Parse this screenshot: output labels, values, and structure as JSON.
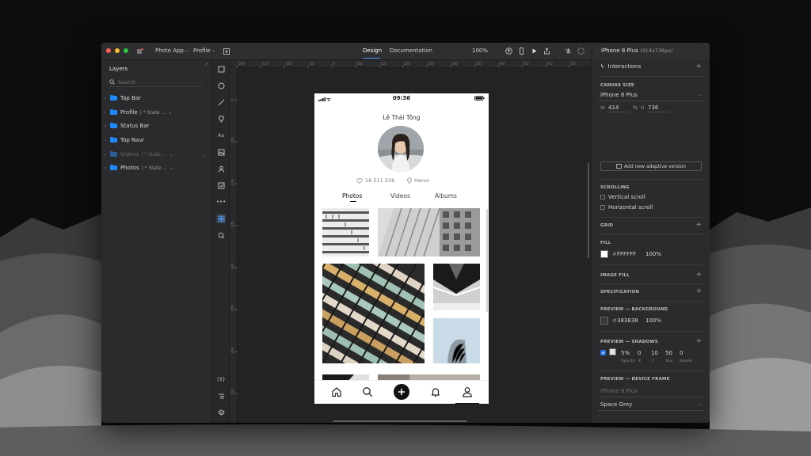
{
  "titlebar": {
    "project": "Photo App",
    "separator": "—",
    "page": "Profile",
    "tabs": [
      "Design",
      "Documentation"
    ],
    "zoom": "100%"
  },
  "layers": {
    "title": "Layers",
    "search_placeholder": "Search",
    "items": [
      {
        "name": "Tap Bar",
        "state": ""
      },
      {
        "name": "Profile",
        "state": "| * State ..."
      },
      {
        "name": "Status Bar",
        "state": ""
      },
      {
        "name": "Top Navi",
        "state": ""
      },
      {
        "name": "Videos",
        "state": "| * State ..."
      },
      {
        "name": "Photos",
        "state": "| * State ..."
      }
    ]
  },
  "ruler": {
    "top": [
      "-200",
      "-150",
      "-100",
      "-50",
      "0",
      "100",
      "150",
      "200",
      "250",
      "300",
      "350",
      "400",
      "450",
      "500",
      "550"
    ],
    "left": [
      "0",
      "100",
      "200",
      "300",
      "400",
      "500",
      "600",
      "700"
    ]
  },
  "toolbar_bottom_label": "{$}",
  "phone": {
    "time": "09:36",
    "name": "Lê Thái Tông",
    "likes": "16 511 256",
    "location": "Hanoi",
    "tabs": [
      "Photos",
      "Videos",
      "Albums"
    ]
  },
  "inspector": {
    "device": "iPhone 8 Plus",
    "device_size": "(414x736px)",
    "interactions": "Interactions",
    "canvas_size_title": "CANVAS SIZE",
    "canvas_device": "iPhone 8 Plus",
    "w_label": "W",
    "width": "414",
    "h_label": "H",
    "height": "736",
    "adaptive_button": "Add new adaptive version",
    "scrolling_title": "SCROLLING",
    "vertical_scroll": "Vertical scroll",
    "horizontal_scroll": "Horizontal scroll",
    "grid_title": "GRID",
    "fill_title": "FILL",
    "fill_hex": "FFFFFF",
    "fill_opacity": "100%",
    "image_fill_title": "IMAGE FILL",
    "specification_title": "SPECIFICATION",
    "bg_title": "PREVIEW — BACKGROUND",
    "bg_hex": "383838",
    "bg_opacity": "100%",
    "shadows_title": "PREVIEW — SHADOWS",
    "shadow_opacity": "5%",
    "shadow_x": "0",
    "shadow_y": "10",
    "shadow_blur": "50",
    "shadow_spread": "0",
    "shadow_labels": [
      "Opacity",
      "X",
      "Y",
      "Blur",
      "Spread"
    ],
    "frame_title": "PREVIEW — DEVICE FRAME",
    "frame_device": "iPhone 8 Plus",
    "frame_color": "Space Grey"
  },
  "colors": {
    "accent": "#4a90e2",
    "folder": "#1e88ff",
    "fill": "#FFFFFF",
    "preview_bg": "#383838"
  }
}
